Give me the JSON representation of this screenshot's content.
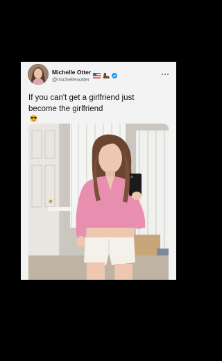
{
  "tweet": {
    "author": {
      "display_name": "Michelle Otter",
      "handle": "@michellexotter",
      "name_emojis": [
        "flag-emoji",
        "boot-emoji"
      ],
      "verified": true
    },
    "text_line_1": "If you can't get a girlfriend just",
    "text_line_2": "become the girlfriend",
    "text_emoji": "sunglasses-emoji",
    "has_media": true
  },
  "colors": {
    "page_background": "#000000",
    "card_background": "#f3f3f3",
    "text_primary": "#0f1419",
    "text_secondary": "#536471",
    "verified_blue": "#1d9bf0"
  },
  "icons": {
    "more": "more-horizontal-icon",
    "verified": "verified-badge-icon"
  }
}
